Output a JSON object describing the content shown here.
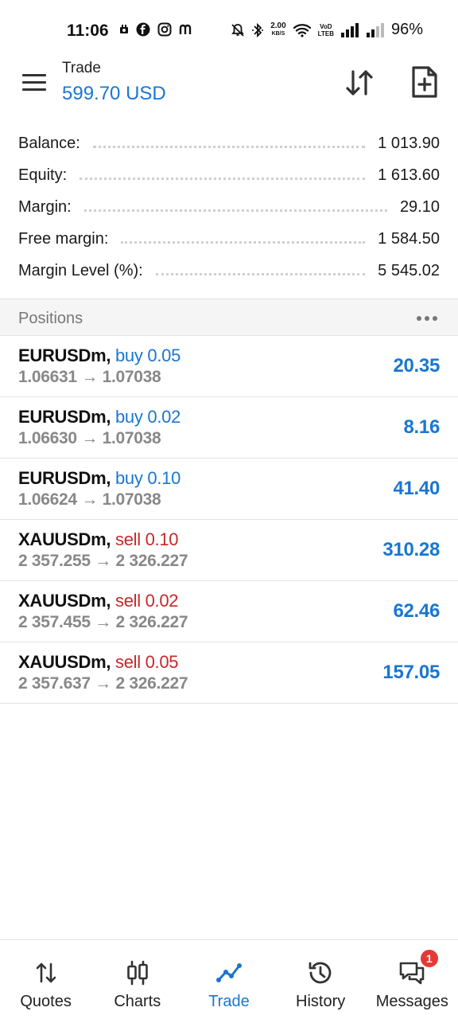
{
  "status_bar": {
    "time": "11:06",
    "net_speed": "2.00",
    "net_speed_unit": "KB/S",
    "carrier_tag_1": "VoD",
    "carrier_tag_2": "LTEB",
    "battery": "96%"
  },
  "header": {
    "title": "Trade",
    "balance_display": "599.70 USD"
  },
  "summary": [
    {
      "label": "Balance:",
      "value": "1 013.90"
    },
    {
      "label": "Equity:",
      "value": "1 613.60"
    },
    {
      "label": "Margin:",
      "value": "29.10"
    },
    {
      "label": "Free margin:",
      "value": "1 584.50"
    },
    {
      "label": "Margin Level (%):",
      "value": "5 545.02"
    }
  ],
  "positions_header": {
    "title": "Positions"
  },
  "positions": [
    {
      "symbol": "EURUSDm,",
      "side": "buy 0.05",
      "prices": "1.06631 → 1.07038",
      "profit": "20.35"
    },
    {
      "symbol": "EURUSDm,",
      "side": "buy 0.02",
      "prices": "1.06630 → 1.07038",
      "profit": "8.16"
    },
    {
      "symbol": "EURUSDm,",
      "side": "buy 0.10",
      "prices": "1.06624 → 1.07038",
      "profit": "41.40"
    },
    {
      "symbol": "XAUUSDm,",
      "side": "sell 0.10",
      "prices": "2 357.255 → 2 326.227",
      "profit": "310.28"
    },
    {
      "symbol": "XAUUSDm,",
      "side": "sell 0.02",
      "prices": "2 357.455 → 2 326.227",
      "profit": "62.46"
    },
    {
      "symbol": "XAUUSDm,",
      "side": "sell 0.05",
      "prices": "2 357.637 → 2 326.227",
      "profit": "157.05"
    }
  ],
  "bottom_nav": [
    {
      "label": "Quotes",
      "icon": "quotes-arrows-icon"
    },
    {
      "label": "Charts",
      "icon": "candlestick-icon"
    },
    {
      "label": "Trade",
      "icon": "trade-line-icon",
      "active": true
    },
    {
      "label": "History",
      "icon": "history-clock-icon"
    },
    {
      "label": "Messages",
      "icon": "messages-chat-icon",
      "badge": "1"
    }
  ],
  "colors": {
    "accent": "#1976d2",
    "sell": "#c62828",
    "badge": "#e53935"
  }
}
